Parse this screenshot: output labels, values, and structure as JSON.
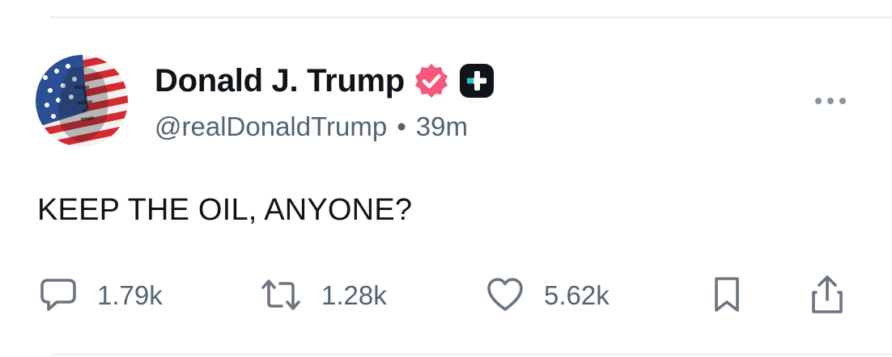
{
  "author": {
    "display_name": "Donald J. Trump",
    "handle": "@realDonaldTrump",
    "separator": "•",
    "time_ago": "39m",
    "avatar_icon": "flag-portrait-avatar",
    "verified_icon": "verified-badge-icon",
    "verified_color": "#f4587a",
    "plus_icon": "plus-badge-icon"
  },
  "post": {
    "text": "KEEP THE OIL, ANYONE?"
  },
  "actions": {
    "reply": {
      "icon": "reply-icon",
      "count": "1.79k"
    },
    "repost": {
      "icon": "repost-icon",
      "count": "1.28k"
    },
    "like": {
      "icon": "heart-icon",
      "count": "5.62k"
    },
    "bookmark": {
      "icon": "bookmark-icon"
    },
    "share": {
      "icon": "share-icon"
    }
  },
  "more_icon": "more-dots-icon",
  "colors": {
    "text": "#0f1419",
    "secondary": "#536471",
    "icon": "#6b7680",
    "divider": "#eceff1"
  }
}
